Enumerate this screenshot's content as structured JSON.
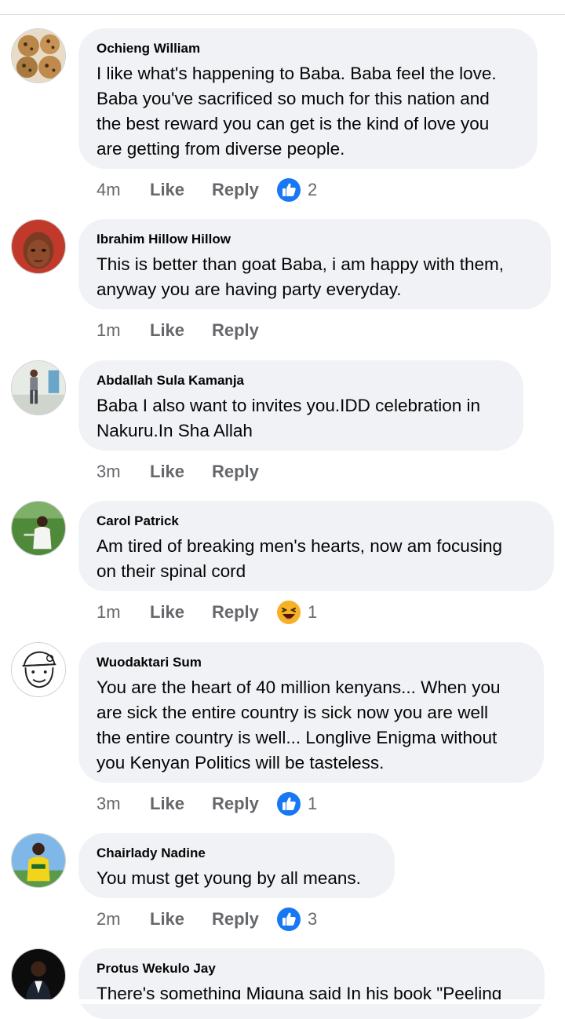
{
  "comments": [
    {
      "author": "Ochieng William",
      "text": "I like what's happening to Baba. Baba feel the love.\nBaba you've sacrificed so much for this nation and\nthe best reward you can get is the kind of love you\nare getting from diverse people.",
      "time": "4m",
      "like": "Like",
      "reply": "Reply",
      "reaction": "like",
      "count": "2",
      "avatar": "cookies-photo"
    },
    {
      "author": "Ibrahim Hillow Hillow",
      "text": "This is better than goat Baba,  i am happy with them,\nanyway you are  having party everyday.",
      "time": "1m",
      "like": "Like",
      "reply": "Reply",
      "reaction": "",
      "count": "",
      "avatar": "red-portrait-photo"
    },
    {
      "author": "Abdallah Sula Kamanja",
      "text": "Baba I also want to invites you.IDD celebration in\nNakuru.In Sha Allah",
      "time": "3m",
      "like": "Like",
      "reply": "Reply",
      "reaction": "",
      "count": "",
      "avatar": "standing-person-photo"
    },
    {
      "author": "Carol Patrick",
      "text": "Am tired of breaking men's hearts,  now am focusing\non their spinal cord",
      "time": "1m",
      "like": "Like",
      "reply": "Reply",
      "reaction": "haha",
      "count": "1",
      "avatar": "garden-person-photo"
    },
    {
      "author": "Wuodaktari Sum",
      "text": "You are the heart of 40 million kenyans... When you\nare sick the entire country is sick now you are well\nthe entire country is well... Longlive Enigma without\nyou Kenyan Politics will be tasteless.",
      "time": "3m",
      "like": "Like",
      "reply": "Reply",
      "reaction": "like",
      "count": "1",
      "avatar": "cartoon-sketch"
    },
    {
      "author": "Chairlady Nadine",
      "text": "You must get young by all means.",
      "time": "2m",
      "like": "Like",
      "reply": "Reply",
      "reaction": "like",
      "count": "3",
      "avatar": "yellow-outfit-photo"
    },
    {
      "author": "Protus Wekulo Jay",
      "text": "There's something Miguna said In his book \"Peeling",
      "time": "",
      "like": "",
      "reply": "",
      "reaction": "",
      "count": "",
      "avatar": "suit-portrait-photo"
    }
  ],
  "colors": {
    "bubble_bg": "#f0f2f5",
    "meta_text": "#65676b",
    "like_blue": "#1877f2",
    "haha_yellow": "#f7b125"
  }
}
